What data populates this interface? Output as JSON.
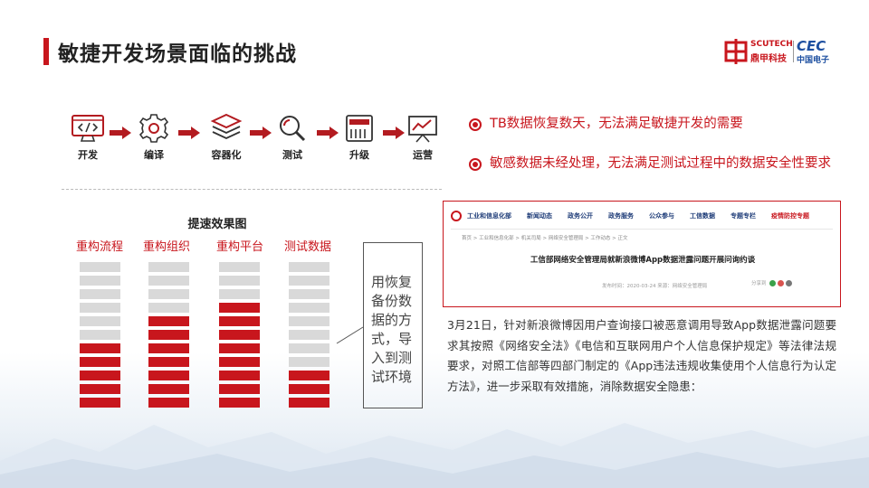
{
  "title": "敏捷开发场景面临的挑战",
  "logo": {
    "brand_en": "SCUTECH",
    "brand_cn": "鼎甲科技",
    "partner_en": "CEC",
    "partner_cn": "中国电子"
  },
  "process": {
    "steps": [
      {
        "label": "开发",
        "icon": "code-monitor-icon"
      },
      {
        "label": "编译",
        "icon": "gear-icon"
      },
      {
        "label": "容器化",
        "icon": "container-stack-icon"
      },
      {
        "label": "测试",
        "icon": "magnifier-icon"
      },
      {
        "label": "升级",
        "icon": "server-icon"
      },
      {
        "label": "运营",
        "icon": "presentation-chart-icon"
      }
    ]
  },
  "chart": {
    "title": "提速效果图",
    "columns": [
      {
        "label": "重构流程",
        "filled": 5,
        "total": 11
      },
      {
        "label": "重构组织",
        "filled": 7,
        "total": 11
      },
      {
        "label": "重构平台",
        "filled": 8,
        "total": 11
      },
      {
        "label": "测试数据",
        "filled": 3,
        "total": 11
      }
    ],
    "colors": {
      "filled": "#c8161d",
      "empty": "#d9d9d9"
    }
  },
  "note": "用恢复备份数据的方式，导入到测试环境",
  "bullets": [
    "TB数据恢复数天，无法满足敏捷开发的需要",
    "敏感数据未经处理，无法满足测试过程中的数据安全性要求"
  ],
  "webpage": {
    "nav": [
      "工业和信息化部",
      "新闻动态",
      "政务公开",
      "政务服务",
      "公众参与",
      "工信数据",
      "专题专栏",
      "疫情防控专题"
    ],
    "breadcrumb": "首页 > 工业和信息化部 > 机关司局 > 网络安全管理局 > 工作动态 > 正文",
    "headline": "工信部网络安全管理局就新浪微博App数据泄露问题开展问询约谈",
    "meta": "发布时间：2020-03-24   来源：网络安全管理局",
    "share": "分享到"
  },
  "paragraph": "3月21日，针对新浪微博因用户查询接口被恶意调用导致App数据泄露问题要求其按照《网络安全法》《电信和互联网用户个人信息保护规定》等法律法规要求，对照工信部等四部门制定的《App违法违规收集使用个人信息行为认定方法》，进一步采取有效措施，消除数据安全隐患：",
  "colors": {
    "accent": "#c8161d",
    "brand_blue": "#1d4fa0"
  }
}
